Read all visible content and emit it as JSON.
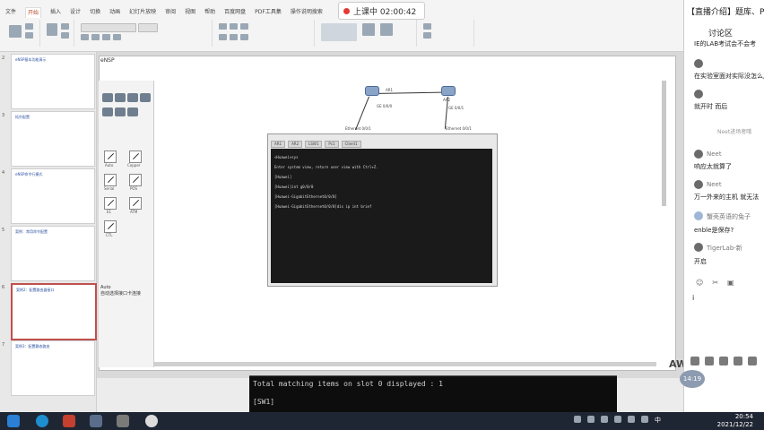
{
  "ribbon": {
    "tabs": [
      "文件",
      "开始",
      "插入",
      "设计",
      "切换",
      "动画",
      "幻灯片放映",
      "审阅",
      "视图",
      "帮助",
      "百度网盘",
      "PDF工具集",
      "操作说明搜索"
    ],
    "active_tab": "开始"
  },
  "recording": {
    "label": "上课中 02:00:42"
  },
  "thumbnails": [
    {
      "num": "2",
      "title": "eNSP基本功能演示"
    },
    {
      "num": "3",
      "title": "拓扑配置"
    },
    {
      "num": "4",
      "title": "eNSP命令行模式"
    },
    {
      "num": "5",
      "title": "案例：常用命令配置"
    },
    {
      "num": "6",
      "title": "案例2：配置路由器接口"
    },
    {
      "num": "7",
      "title": "案例3：配置静态路由"
    }
  ],
  "ensp": {
    "title": "eNSP",
    "palette_tools": [
      "Auto",
      "Copper",
      "Serial",
      "POS",
      "E1",
      "ATM",
      "CTL"
    ],
    "description_title": "Auto",
    "description_text": "自动选择接口卡连接"
  },
  "topology": {
    "devices": [
      {
        "name": "AR1"
      },
      {
        "name": "AR2"
      }
    ],
    "port_labels": [
      "GE 0/0/0",
      "GE 0/0/1",
      "Ethernet 0/0/1",
      "Ethernet 0/0/1"
    ]
  },
  "cli": {
    "tabs": [
      "AR1",
      "AR2",
      "LSW1",
      "Pc1",
      "Client1"
    ],
    "lines": [
      "<Huawei>sys",
      "Enter system view, return user view with Ctrl+Z.",
      "[Huawei]",
      "[Huawei]int g0/0/0",
      "[Huawei-GigabitEthernet0/0/0]",
      "",
      "[Huawei-GigabitEthernet0/0/0]dis ip int brief"
    ]
  },
  "terminal": {
    "lines": [
      "Total matching items on slot 0 displayed : 1",
      "[SW1]"
    ]
  },
  "aw_label": "AW",
  "chat": {
    "header": "【直播介绍】题库、PN",
    "tab_label": "讨论区",
    "messages": [
      {
        "name": "",
        "text": "IE的LAB考试会不会考"
      },
      {
        "name": "",
        "text": "在实验室面对实际没怎么用"
      },
      {
        "name": "",
        "text": "就开时 而后"
      },
      {
        "name": "",
        "text": "Neet进场者哦"
      },
      {
        "name": "Neet",
        "text": "响应太就算了"
      },
      {
        "name": "Neet",
        "text": "万一外来的主机 就无法"
      },
      {
        "name": "",
        "text": "蟹壳英语的兔子"
      },
      {
        "name": "",
        "text": "enble是保存?"
      },
      {
        "name": "TigerLab-新",
        "text": "开启"
      }
    ],
    "input_text": "i",
    "timer": "14:19"
  },
  "taskbar": {
    "time": "20:54",
    "date": "2021/12/22",
    "ime": "中"
  }
}
